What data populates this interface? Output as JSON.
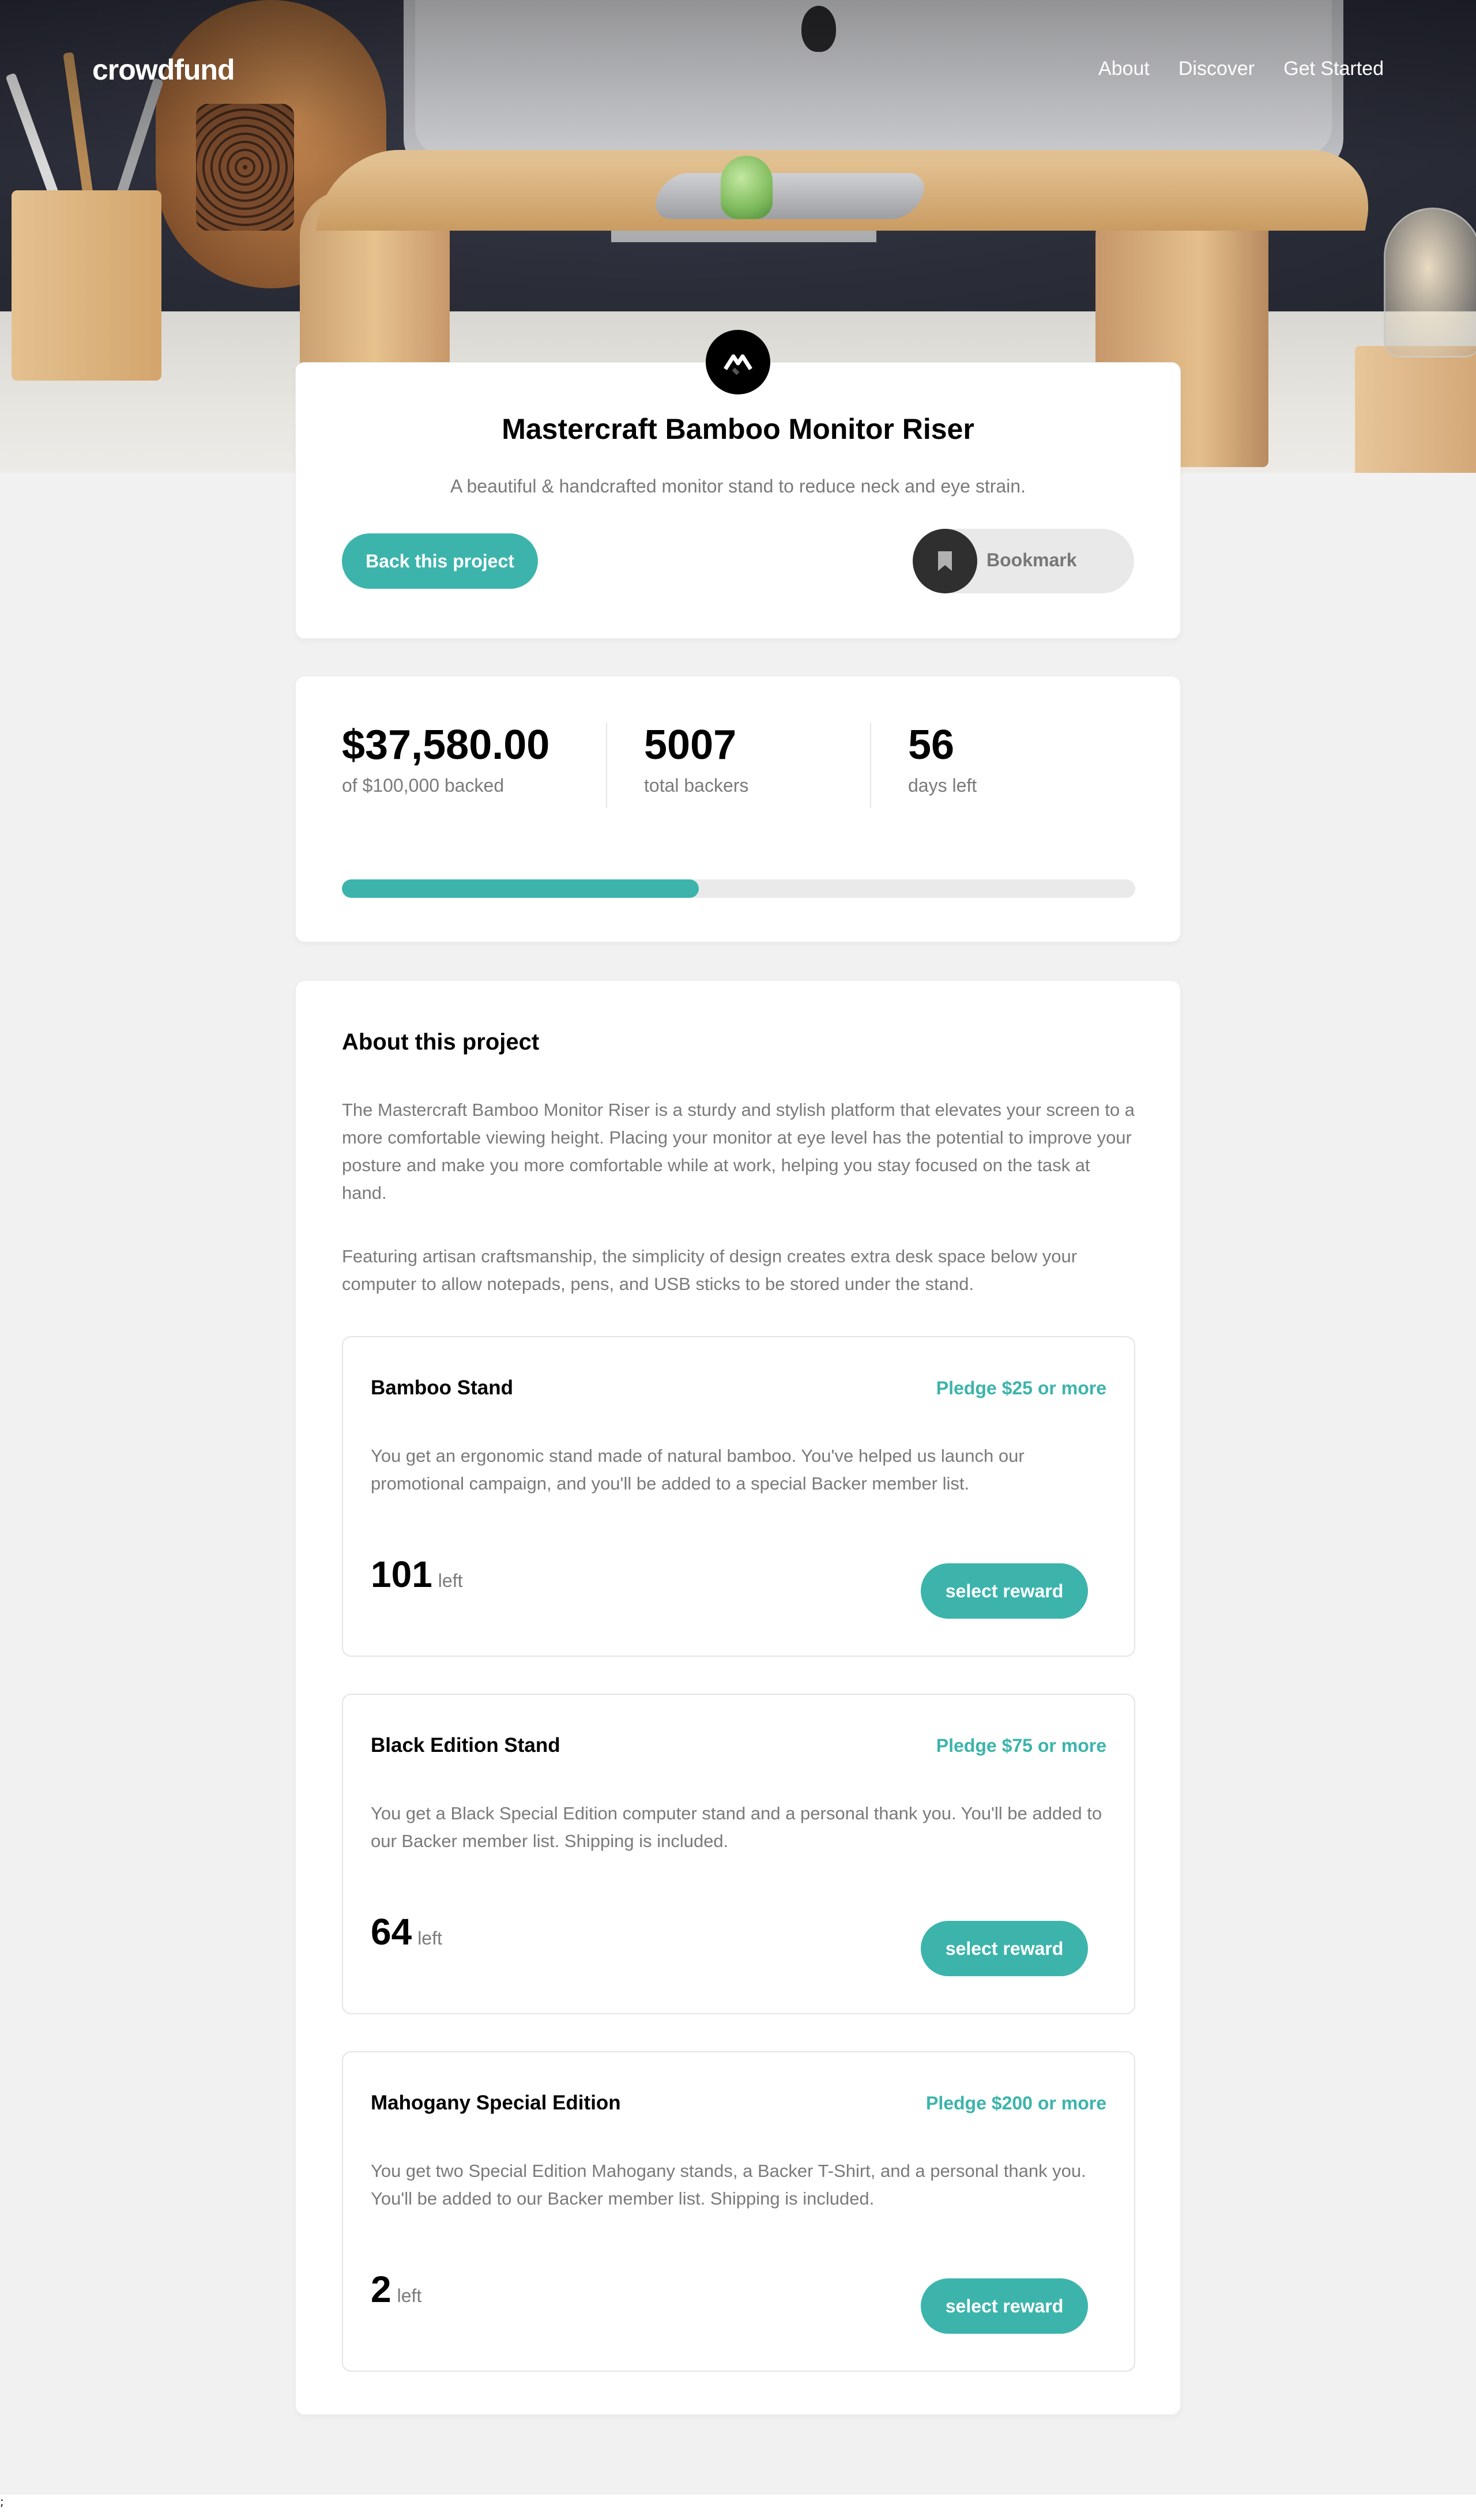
{
  "header": {
    "logo": "crowdfund",
    "nav": [
      "About",
      "Discover",
      "Get Started"
    ]
  },
  "intro": {
    "title": "Mastercraft Bamboo Monitor Riser",
    "subtitle": "A beautiful & handcrafted monitor stand to reduce neck and eye strain.",
    "back_button": "Back this project",
    "bookmark_label": "Bookmark",
    "icons": [
      "mastercraft-logo-icon",
      "bookmark-icon"
    ]
  },
  "stats": {
    "backed_amount": "$37,580.00",
    "backed_label": "of $100,000 backed",
    "backers": "5007",
    "backers_label": "total backers",
    "days": "56",
    "days_label": "days left",
    "progress_fraction": 0.45
  },
  "about": {
    "title": "About this project",
    "paragraphs": [
      "The Mastercraft Bamboo Monitor Riser is a sturdy and stylish platform that elevates your screen to a more comfortable viewing height. Placing your monitor at eye level has the potential to improve your posture and make you more comfortable while at work, helping you stay focused on the task at hand.",
      "Featuring artisan craftsmanship, the simplicity of design creates extra desk space below your computer to allow notepads, pens, and USB sticks to be stored under the stand."
    ],
    "rewards": [
      {
        "name": "Bamboo Stand",
        "pledge": "Pledge $25 or more",
        "description": "You get an ergonomic stand made of natural bamboo. You've helped us launch our promotional campaign, and you'll be added to a special Backer member list.",
        "left": "101",
        "left_label": "left",
        "button": "select reward"
      },
      {
        "name": "Black Edition Stand",
        "pledge": "Pledge $75 or more",
        "description": "You get a Black Special Edition computer stand and a personal thank you. You'll be added to our Backer member list. Shipping is included.",
        "left": "64",
        "left_label": "left",
        "button": "select reward"
      },
      {
        "name": "Mahogany Special Edition",
        "pledge": "Pledge $200 or more",
        "description": "You get two Special Edition Mahogany stands, a Backer T-Shirt, and a personal thank you. You'll be added to our Backer member list. Shipping is included.",
        "left": "2",
        "left_label": "left",
        "button": "select reward"
      }
    ]
  },
  "footer_mark": ";",
  "colors": {
    "accent": "#3cb4ac",
    "background": "#f1f1f1",
    "card": "#ffffff",
    "muted_text": "#7a7a7a"
  }
}
